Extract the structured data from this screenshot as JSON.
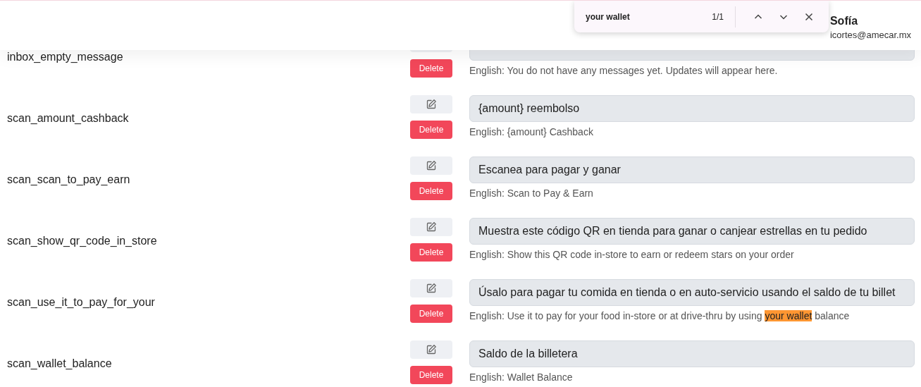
{
  "header": {
    "user_name": "Sofía",
    "user_email": "icortes@amecar.mx"
  },
  "find_bar": {
    "query": "your wallet",
    "count": "1/1"
  },
  "rows": [
    {
      "key": "inbox_empty_message",
      "value": "",
      "english_parts": [
        {
          "text": "English: You do not have any messages yet. Updates will appear here.",
          "highlighted": false
        }
      ],
      "delete_label": "Delete"
    },
    {
      "key": "scan_amount_cashback",
      "value": "{amount} reembolso",
      "english_parts": [
        {
          "text": "English: {amount} Cashback",
          "highlighted": false
        }
      ],
      "delete_label": "Delete"
    },
    {
      "key": "scan_scan_to_pay_earn",
      "value": "Escanea para pagar y ganar",
      "english_parts": [
        {
          "text": "English: Scan to Pay & Earn",
          "highlighted": false
        }
      ],
      "delete_label": "Delete"
    },
    {
      "key": "scan_show_qr_code_in_store",
      "value": "Muestra este código QR en tienda para ganar o canjear estrellas en tu pedido",
      "english_parts": [
        {
          "text": "English: Show this QR code in-store to earn or redeem stars on your order",
          "highlighted": false
        }
      ],
      "delete_label": "Delete"
    },
    {
      "key": "scan_use_it_to_pay_for_your",
      "value": "Úsalo para pagar tu comida en tienda o en auto-servicio usando el saldo de tu billet",
      "english_parts": [
        {
          "text": "English: Use it to pay for your food in-store or at drive-thru by using ",
          "highlighted": false
        },
        {
          "text": "your wallet",
          "highlighted": true
        },
        {
          "text": " balance",
          "highlighted": false
        }
      ],
      "delete_label": "Delete"
    },
    {
      "key": "scan_wallet_balance",
      "value": "Saldo de la billetera",
      "english_parts": [
        {
          "text": "English: Wallet Balance",
          "highlighted": false
        }
      ],
      "delete_label": "Delete"
    }
  ]
}
